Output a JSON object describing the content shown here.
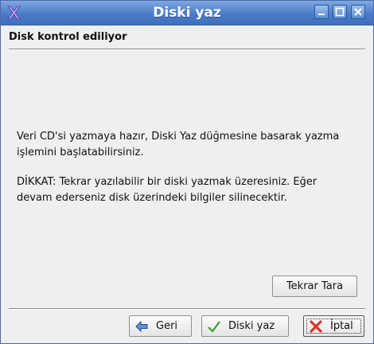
{
  "window": {
    "title": "Diski yaz"
  },
  "title_buttons": {
    "minimize": "minimize-icon",
    "maximize": "maximize-icon",
    "close": "close-icon"
  },
  "page": {
    "header": "Disk kontrol ediliyor",
    "message1_line1": "Veri CD'si yazmaya hazır, Diski Yaz düğmesine basarak yazma",
    "message1_line2": "işlemini başlatabilirsiniz.",
    "message2_line1": "DİKKAT: Tekrar yazılabilir bir diski yazmak üzeresiniz. Eğer",
    "message2_line2": "devam ederseniz disk üzerindeki bilgiler silinecektir."
  },
  "buttons": {
    "rescan": "Tekrar Tara",
    "back": "Geri",
    "burn": "Diski yaz",
    "cancel": "İptal"
  },
  "icons": {
    "back": "back-arrow-icon",
    "burn": "checkmark-icon",
    "cancel": "cancel-x-icon"
  },
  "colors": {
    "titlebar": "#4b7cc8",
    "window_bg": "#efefef",
    "cancel_icon": "#d9342b",
    "check_icon": "#3a9a3a"
  }
}
